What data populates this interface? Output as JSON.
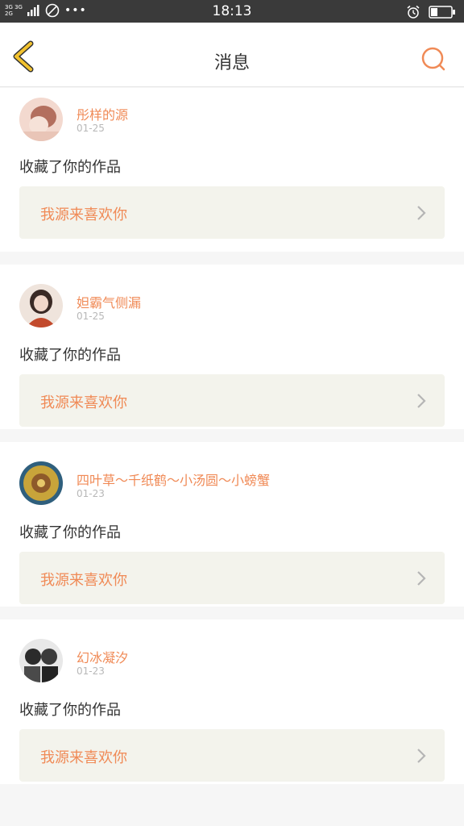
{
  "status_bar": {
    "network_top": "3G 3G",
    "network_bottom": "2G",
    "time": "18:13"
  },
  "header": {
    "title": "消息"
  },
  "notifications": [
    {
      "username": "彤样的源",
      "date": "01-25",
      "action": "收藏了你的作品",
      "work_title": "我源来喜欢你",
      "avatar_colors": [
        "#f3d9cf",
        "#b36f5e"
      ]
    },
    {
      "username": "妲霸气侧漏",
      "date": "01-25",
      "action": "收藏了你的作品",
      "work_title": "我源来喜欢你",
      "avatar_colors": [
        "#efe4dc",
        "#c24a2c"
      ]
    },
    {
      "username": "四叶草～千纸鹤～小汤圆～小螃蟹",
      "date": "01-23",
      "action": "收藏了你的作品",
      "work_title": "我源来喜欢你",
      "avatar_colors": [
        "#c8a43a",
        "#2f5f7d"
      ]
    },
    {
      "username": "幻冰凝汐",
      "date": "01-23",
      "action": "收藏了你的作品",
      "work_title": "我源来喜欢你",
      "avatar_colors": [
        "#e8e8e8",
        "#2b2b2b"
      ]
    }
  ],
  "colors": {
    "accent": "#f08a56",
    "back_arrow": "#f2c22e",
    "link_bg": "#f3f3ec"
  }
}
